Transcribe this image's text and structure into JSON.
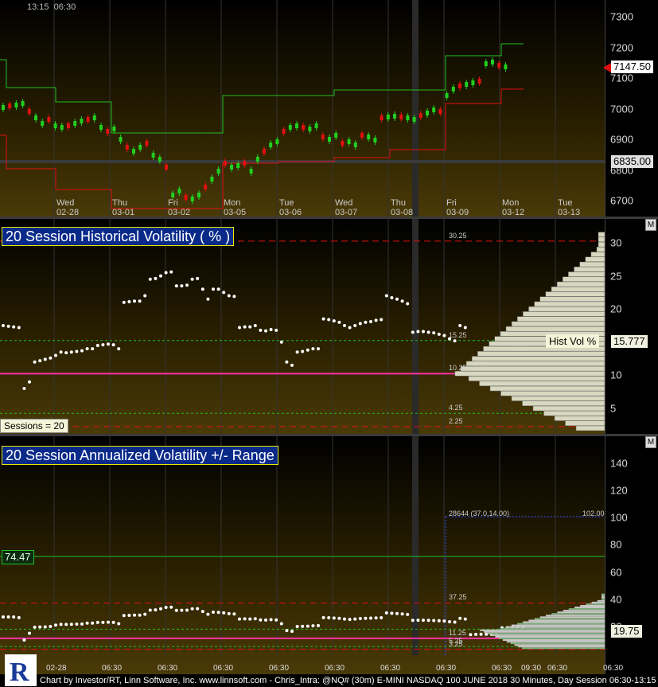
{
  "price_pane": {
    "header_time": "13:15",
    "header_time2": "06:30",
    "y_ticks": [
      "7300",
      "7200",
      "7100",
      "7000",
      "6900",
      "6800",
      "6700"
    ],
    "last_price_tag": "7147.50",
    "cursor_price_tag": "6835.00",
    "days": [
      {
        "name": "Wed",
        "date": "02-28"
      },
      {
        "name": "Thu",
        "date": "03-01"
      },
      {
        "name": "Fri",
        "date": "03-02"
      },
      {
        "name": "Mon",
        "date": "03-05"
      },
      {
        "name": "Tue",
        "date": "03-06"
      },
      {
        "name": "Wed",
        "date": "03-07"
      },
      {
        "name": "Thu",
        "date": "03-08"
      },
      {
        "name": "Fri",
        "date": "03-09"
      },
      {
        "name": "Mon",
        "date": "03-12"
      },
      {
        "name": "Tue",
        "date": "03-13"
      }
    ],
    "colors": {
      "up": "#20d020",
      "down": "#e01010",
      "upper_band": "#20c020",
      "lower_band": "#e01010"
    }
  },
  "hist_vol_pane": {
    "title": "20 Session Historical Volatility ( % )",
    "y_ticks": [
      "30",
      "25",
      "20",
      "15",
      "10",
      "5"
    ],
    "levels": [
      "30.25",
      "15.25",
      "10.25",
      "4.25",
      "2.25"
    ],
    "hv_label": "Hist Vol %",
    "hv_value": "15.777",
    "sessions_label": "Sessions = 20",
    "m_label": "M"
  },
  "ann_vol_pane": {
    "title": "20 Session Annualized Volatility +/- Range",
    "y_ticks": [
      "140",
      "120",
      "100",
      "80",
      "60",
      "40",
      "20"
    ],
    "left_tag": "74.47",
    "right_tag": "19.75",
    "range_label": "28644 (37.0,14.00)",
    "range_value": "102.00",
    "levels": [
      "37.25",
      "11.25",
      "5.25",
      "3.25"
    ],
    "x_labels": [
      "02-28",
      "06:30",
      "06:30",
      "06:30",
      "06:30",
      "06:30",
      "06:30",
      "06:30",
      "06:30",
      "09:30",
      "06:30",
      "06:30"
    ],
    "m_label": "M"
  },
  "footer": {
    "text": "Chart by Investor/RT, Linn Software, Inc. www.linnsoft.com - Chris_Intra: @NQ# (30m) E-MINI NASDAQ 100 JUNE 2018 30 Minutes, Day Session 06:30-13:15 -"
  }
}
